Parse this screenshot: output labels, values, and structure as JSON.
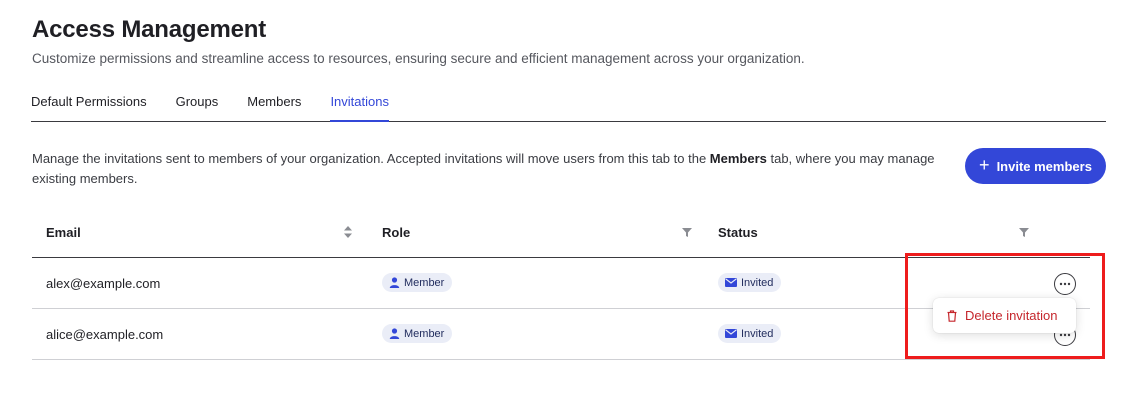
{
  "header": {
    "title": "Access Management",
    "subtitle": "Customize permissions and streamline access to resources, ensuring secure and efficient management across your organization."
  },
  "tabs": [
    {
      "label": "Default Permissions",
      "active": false
    },
    {
      "label": "Groups",
      "active": false
    },
    {
      "label": "Members",
      "active": false
    },
    {
      "label": "Invitations",
      "active": true
    }
  ],
  "intro": {
    "text_before": "Manage the invitations sent to members of your organization. Accepted invitations will move users from this tab to the ",
    "bold": "Members",
    "text_after": " tab, where you may manage existing members."
  },
  "invite_button": {
    "label": "Invite members",
    "icon": "plus-icon"
  },
  "table": {
    "columns": [
      "Email",
      "Role",
      "Status"
    ],
    "rows": [
      {
        "email": "alex@example.com",
        "role": "Member",
        "status": "Invited"
      },
      {
        "email": "alice@example.com",
        "role": "Member",
        "status": "Invited"
      }
    ]
  },
  "row_menu": {
    "items": [
      {
        "label": "Delete invitation",
        "icon": "trash-icon"
      }
    ]
  },
  "colors": {
    "accent": "#3347d8",
    "danger": "#c5262c",
    "badge_bg": "#eaedf7",
    "highlight": "#ee1c1c"
  }
}
